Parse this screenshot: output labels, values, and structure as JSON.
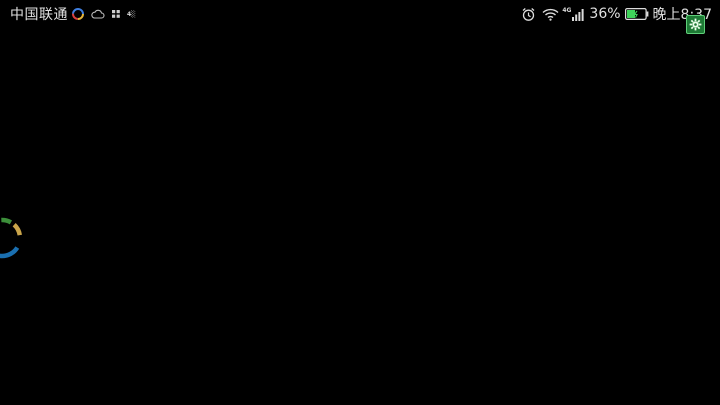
{
  "status_bar": {
    "carrier": "中国联通",
    "tiny_label": "4░",
    "network": "4G",
    "battery_percent": "36%",
    "time": "晚上8:37"
  },
  "icons": {
    "notification_ring": "ring-icon",
    "cloud": "cloud-icon",
    "grid": "grid-icon",
    "alarm": "alarm-icon",
    "wifi": "wifi-icon",
    "signal": "signal-icon",
    "battery": "battery-icon",
    "settings": "gear-icon",
    "loading": "loading-spinner-icon"
  },
  "colors": {
    "background": "#000000",
    "battery_fill": "#3fd35a",
    "gear_bg": "#1e7a35",
    "spinner_blue": "#1a6fb0",
    "spinner_green": "#3c8f3a",
    "spinner_gold": "#c9a44a"
  }
}
